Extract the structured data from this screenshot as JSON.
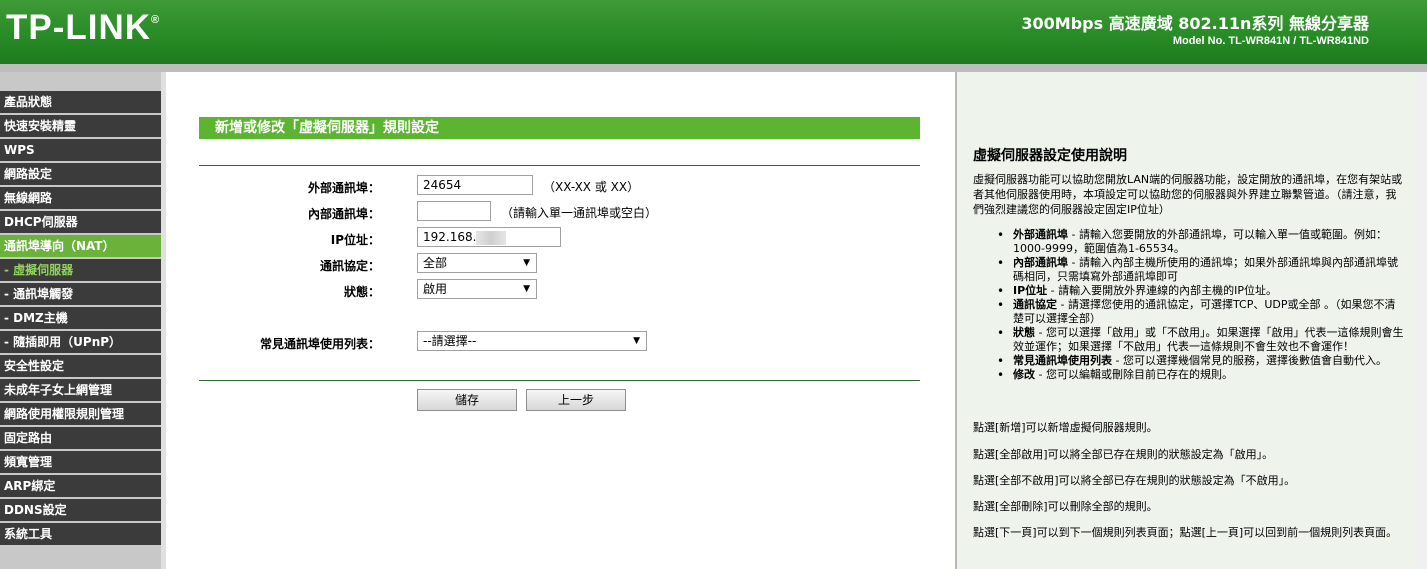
{
  "header": {
    "logo": "TP-LINK",
    "logo_mark": "®",
    "product": "300Mbps 高速廣域 802.11n系列 無線分享器",
    "model": "Model No. TL-WR841N / TL-WR841ND"
  },
  "sidebar": {
    "items": [
      {
        "label": "產品狀態"
      },
      {
        "label": "快速安裝精靈"
      },
      {
        "label": "WPS"
      },
      {
        "label": "網路設定"
      },
      {
        "label": "無線網路"
      },
      {
        "label": "DHCP伺服器"
      },
      {
        "label": "通訊埠導向（NAT）"
      },
      {
        "label": "- 虛擬伺服器"
      },
      {
        "label": "- 通訊埠觸發"
      },
      {
        "label": "- DMZ主機"
      },
      {
        "label": "- 隨插即用（UPnP）"
      },
      {
        "label": "安全性設定"
      },
      {
        "label": "未成年子女上網管理"
      },
      {
        "label": "網路使用權限規則管理"
      },
      {
        "label": "固定路由"
      },
      {
        "label": "頻寬管理"
      },
      {
        "label": "ARP綁定"
      },
      {
        "label": "DDNS設定"
      },
      {
        "label": "系統工具"
      }
    ]
  },
  "main": {
    "title": "新增或修改「虛擬伺服器」規則設定",
    "external_port_label": "外部通訊埠：",
    "external_port_value": "24654",
    "external_port_hint": "（XX-XX 或 XX）",
    "internal_port_label": "內部通訊埠：",
    "internal_port_value": "",
    "internal_port_hint": "（請輸入單一通訊埠或空白）",
    "ip_label": "IP位址：",
    "ip_value": "192.168.",
    "protocol_label": "通訊協定：",
    "protocol_value": "全部",
    "status_label": "狀態：",
    "status_value": "啟用",
    "common_label": "常見通訊埠使用列表：",
    "common_value": "--請選擇--",
    "save_label": "儲存",
    "back_label": "上一步"
  },
  "help": {
    "title": "虛擬伺服器設定使用說明",
    "intro": "虛擬伺服器功能可以協助您開放LAN端的伺服器功能，設定開放的通訊埠，在您有架站或者其他伺服器使用時，本項設定可以協助您的伺服器與外界建立聯繫管道。（請注意，我們強烈建議您的伺服器設定固定IP位址）",
    "bullets": [
      {
        "term": "外部通訊埠",
        "text": " - 請輸入您要開放的外部通訊埠，可以輸入單一值或範圍。例如：1000-9999，範圍值為1-65534。"
      },
      {
        "term": "內部通訊埠",
        "text": " - 請輸入內部主機所使用的通訊埠；如果外部通訊埠與內部通訊埠號碼相同，只需填寫外部通訊埠即可"
      },
      {
        "term": "IP位址",
        "text": " - 請輸入要開放外界連線的內部主機的IP位址。"
      },
      {
        "term": "通訊協定",
        "text": " - 請選擇您使用的通訊協定，可選擇TCP、UDP或全部 。（如果您不清楚可以選擇全部）"
      },
      {
        "term": "狀態",
        "text": " - 您可以選擇「啟用」或「不啟用」。如果選擇「啟用」代表一這條規則會生效並運作；如果選擇「不啟用」代表一這條規則不會生效也不會運作！"
      },
      {
        "term": "常見通訊埠使用列表",
        "text": " - 您可以選擇幾個常見的服務，選擇後數值會自動代入。"
      },
      {
        "term": "修改",
        "text": " - 您可以編輯或刪除目前已存在的規則。"
      }
    ],
    "p1": "點選[新增]可以新增虛擬伺服器規則。",
    "p2": "點選[全部啟用]可以將全部已存在規則的狀態設定為「啟用」。",
    "p3": "點選[全部不啟用]可以將全部已存在規則的狀態設定為「不啟用」。",
    "p4": "點選[全部刪除]可以刪除全部的規則。",
    "p5": "點選[下一頁]可以到下一個規則列表頁面；點選[上一頁]可以回到前一個規則列表頁面。"
  },
  "colors": {
    "brand_green": "#268a25",
    "active_menu": "#6ab23a",
    "menu_bg": "#3b3b3b",
    "title_bar": "#5cb531"
  }
}
